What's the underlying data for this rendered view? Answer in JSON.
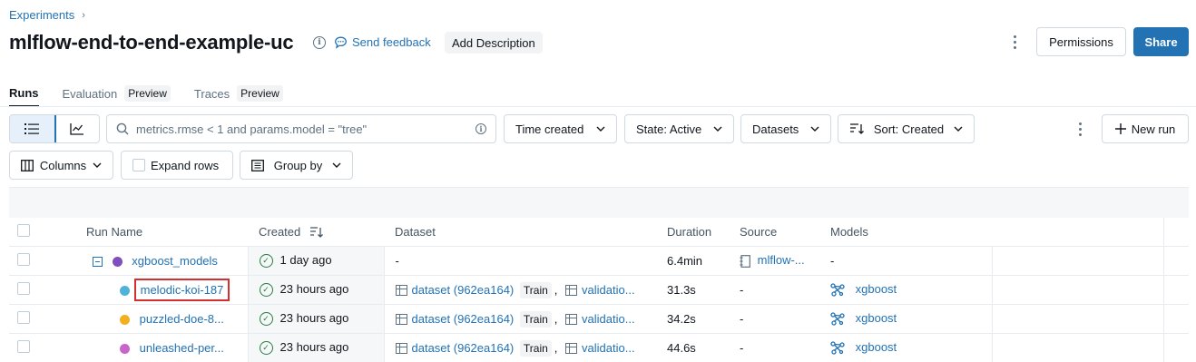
{
  "breadcrumb": {
    "parent": "Experiments",
    "chevron": "›"
  },
  "header": {
    "title": "mlflow-end-to-end-example-uc",
    "info_icon": "i",
    "feedback_label": "Send feedback",
    "add_description_label": "Add Description",
    "permissions_label": "Permissions",
    "share_label": "Share"
  },
  "tabs": [
    {
      "label": "Runs",
      "tag": ""
    },
    {
      "label": "Evaluation",
      "tag": "Preview"
    },
    {
      "label": "Traces",
      "tag": "Preview"
    }
  ],
  "toolbar": {
    "search_placeholder": "metrics.rmse < 1 and params.model = \"tree\"",
    "time_created_label": "Time created",
    "state_label": "State: Active",
    "datasets_label": "Datasets",
    "sort_label": "Sort: Created",
    "new_run_label": "New run",
    "columns_label": "Columns",
    "expand_rows_label": "Expand rows",
    "group_by_label": "Group by"
  },
  "table": {
    "columns": [
      "Run Name",
      "Created",
      "Dataset",
      "Duration",
      "Source",
      "Models"
    ],
    "rows": [
      {
        "name": "xgboost_models",
        "dot_color": "#7f4ebf",
        "created": "1 day ago",
        "dataset": "-",
        "dataset_tag": "",
        "dataset2": "",
        "duration": "6.4min",
        "source": "mlflow-...",
        "models": "-",
        "parent": true
      },
      {
        "name": "melodic-koi-187",
        "dot_color": "#4fb3d9",
        "created": "23 hours ago",
        "dataset": "dataset (962ea164)",
        "dataset_tag": "Train",
        "dataset2": "validatio...",
        "duration": "31.3s",
        "source": "-",
        "models": "xgboost",
        "highlight": true
      },
      {
        "name": "puzzled-doe-8...",
        "dot_color": "#f2b01e",
        "created": "23 hours ago",
        "dataset": "dataset (962ea164)",
        "dataset_tag": "Train",
        "dataset2": "validatio...",
        "duration": "34.2s",
        "source": "-",
        "models": "xgboost"
      },
      {
        "name": "unleashed-per...",
        "dot_color": "#c765c9",
        "created": "23 hours ago",
        "dataset": "dataset (962ea164)",
        "dataset_tag": "Train",
        "dataset2": "validatio...",
        "duration": "44.6s",
        "source": "-",
        "models": "xgboost"
      }
    ]
  },
  "colors": {
    "accent": "#2272b4",
    "success": "#277c43",
    "highlight_border": "#d32f2f"
  }
}
